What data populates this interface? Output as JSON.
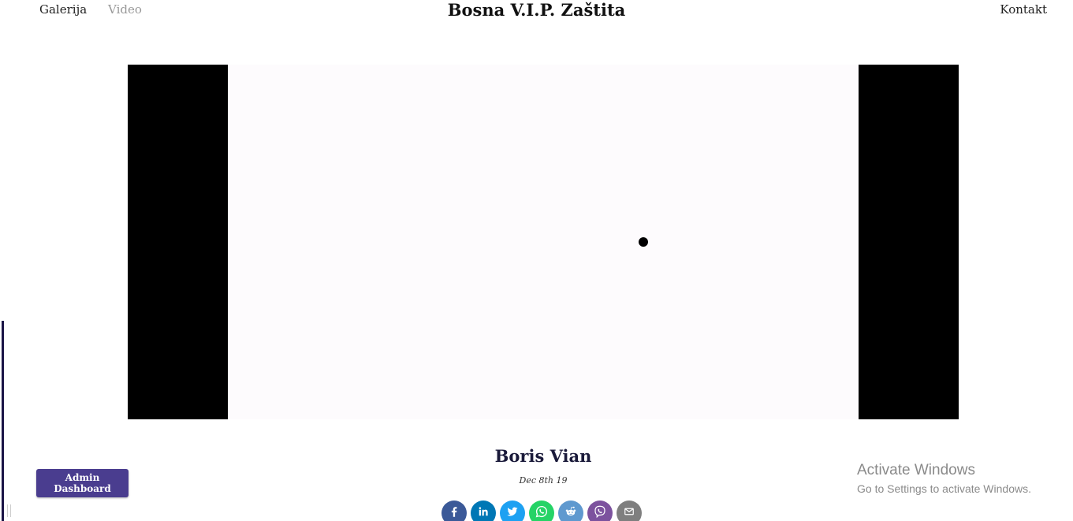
{
  "header": {
    "nav_left": [
      "Galerija",
      "Video"
    ],
    "site_title": "Bosna V.I.P. Zaštita",
    "nav_right": "Kontakt"
  },
  "video": {
    "state": "loading"
  },
  "post": {
    "author": "Boris Vian",
    "date": "Dec 8th 19"
  },
  "share": [
    {
      "icon": "facebook-icon",
      "color": "#3b5998"
    },
    {
      "icon": "linkedin-icon",
      "color": "#0077b5"
    },
    {
      "icon": "twitter-icon",
      "color": "#1da1f2"
    },
    {
      "icon": "whatsapp-icon",
      "color": "#25d366"
    },
    {
      "icon": "reddit-icon",
      "color": "#5f99cf"
    },
    {
      "icon": "viber-icon",
      "color": "#7c529e"
    },
    {
      "icon": "email-icon",
      "color": "#7f7f7f"
    }
  ],
  "admin": {
    "label": "Admin Dashboard",
    "color": "#4a3d8f"
  },
  "watermark": {
    "title": "Activate Windows",
    "subtitle": "Go to Settings to activate Windows."
  }
}
